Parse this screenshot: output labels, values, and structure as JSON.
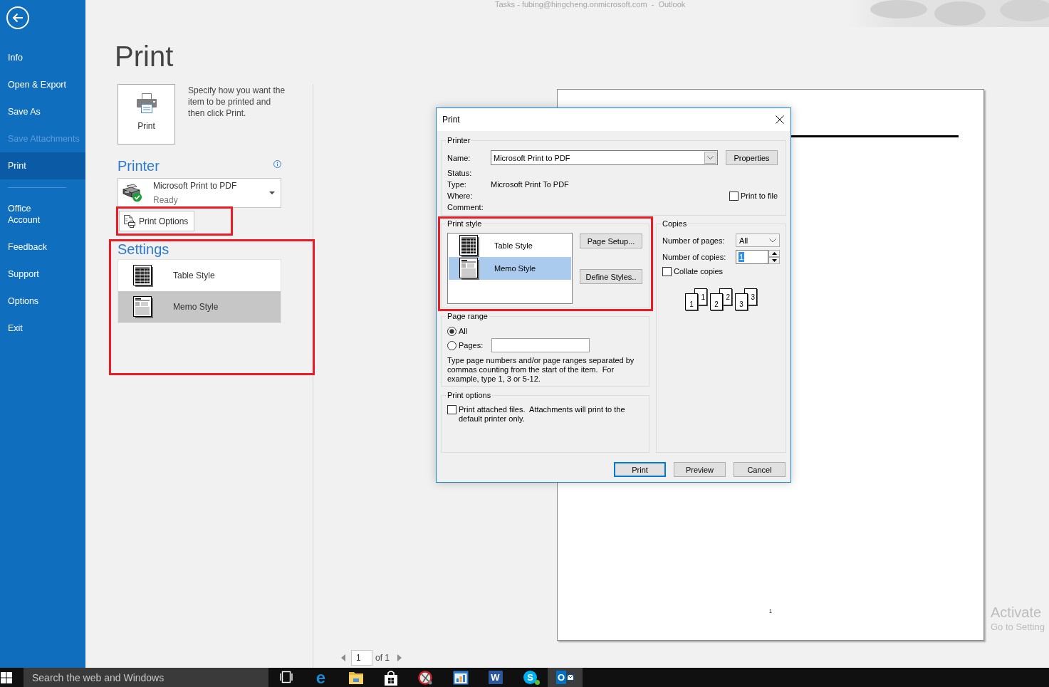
{
  "window_title": "Tasks - fubing@hingcheng.onmicrosoft.com  -  Outlook",
  "sidebar": {
    "sections": [
      {
        "items": [
          {
            "label": "Info",
            "selected": false,
            "disabled": false
          },
          {
            "label": "Open & Export",
            "selected": false,
            "disabled": false
          },
          {
            "label": "Save As",
            "selected": false,
            "disabled": false
          },
          {
            "label": "Save Attachments",
            "selected": false,
            "disabled": true
          },
          {
            "label": "Print",
            "selected": true,
            "disabled": false
          }
        ]
      },
      {
        "items": [
          {
            "label": "Office\nAccount",
            "selected": false,
            "disabled": false
          },
          {
            "label": "Feedback",
            "selected": false,
            "disabled": false
          },
          {
            "label": "Support",
            "selected": false,
            "disabled": false
          },
          {
            "label": "Options",
            "selected": false,
            "disabled": false
          },
          {
            "label": "Exit",
            "selected": false,
            "disabled": false
          }
        ]
      }
    ]
  },
  "backstage": {
    "title": "Print",
    "print_button": "Print",
    "description": "Specify how you want the item to be printed and then click Print.",
    "printer": {
      "heading": "Printer",
      "name": "Microsoft Print to PDF",
      "status": "Ready"
    },
    "print_options_button": {
      "label": "Print Options",
      "highlighted": true
    },
    "settings": {
      "heading": "Settings",
      "highlighted": true,
      "styles": [
        {
          "label": "Table Style",
          "kind": "table",
          "selected": false
        },
        {
          "label": "Memo Style",
          "kind": "memo",
          "selected": true
        }
      ]
    }
  },
  "preview": {
    "page_number": "1",
    "current_page": "1",
    "page_total": "of 1"
  },
  "activation_notice": {
    "title": "Activate",
    "subtitle": "Go to Setting"
  },
  "dialog": {
    "title": "Print",
    "printer": {
      "legend": "Printer",
      "name_label": "Name:",
      "name_value": "Microsoft Print to PDF",
      "properties_button": "Properties",
      "info": [
        {
          "label": "Status:"
        },
        {
          "label": "Type:",
          "value": "Microsoft Print To PDF"
        },
        {
          "label": "Where:"
        },
        {
          "label": "Comment:"
        }
      ],
      "print_to_file": {
        "label": "Print to file",
        "checked": false
      }
    },
    "print_style": {
      "legend": "Print style",
      "highlighted": true,
      "styles": [
        {
          "label": "Table Style",
          "kind": "table",
          "selected": false
        },
        {
          "label": "Memo Style",
          "kind": "memo",
          "selected": true
        }
      ],
      "buttons": [
        "Page Setup...",
        "Define Styles.."
      ]
    },
    "copies": {
      "legend": "Copies",
      "pages_label": "Number of pages:",
      "pages_value": "All",
      "copies_label": "Number of copies:",
      "copies_value": "1",
      "copies_value_selected": true,
      "collate": {
        "label": "Collate copies",
        "checked": false
      },
      "stacks": [
        {
          "back": "1",
          "front": "1"
        },
        {
          "back": "2",
          "front": "2"
        },
        {
          "back": "3",
          "front": "3"
        }
      ]
    },
    "page_range": {
      "legend": "Page range",
      "options": [
        {
          "label": "All",
          "kind": "all",
          "selected": true
        },
        {
          "label": "Pages:",
          "kind": "range",
          "selected": false
        }
      ],
      "hint": "Type page numbers and/or page ranges separated by commas counting from the start of the item.  For example, type 1, 3 or 5-12."
    },
    "print_options": {
      "legend": "Print options",
      "attach": {
        "label": "Print attached files.  Attachments will print to the default printer only.",
        "checked": false
      }
    },
    "buttons": [
      {
        "label": "Print",
        "default": true
      },
      {
        "label": "Preview",
        "default": false
      },
      {
        "label": "Cancel",
        "default": false
      }
    ]
  },
  "taskbar": {
    "search_placeholder": "Search the web and Windows",
    "apps": [
      {
        "kind": "task-view",
        "active": false
      },
      {
        "kind": "browser",
        "letter": "e",
        "active": false
      },
      {
        "kind": "folder",
        "active": false
      },
      {
        "kind": "bag",
        "active": false
      },
      {
        "kind": "scissors",
        "active": false
      },
      {
        "kind": "chart",
        "active": false
      },
      {
        "kind": "document",
        "letter": "W",
        "active": false
      },
      {
        "kind": "chat",
        "letter": "S",
        "active": false
      },
      {
        "kind": "mail",
        "letter": "O",
        "active": true
      }
    ]
  }
}
